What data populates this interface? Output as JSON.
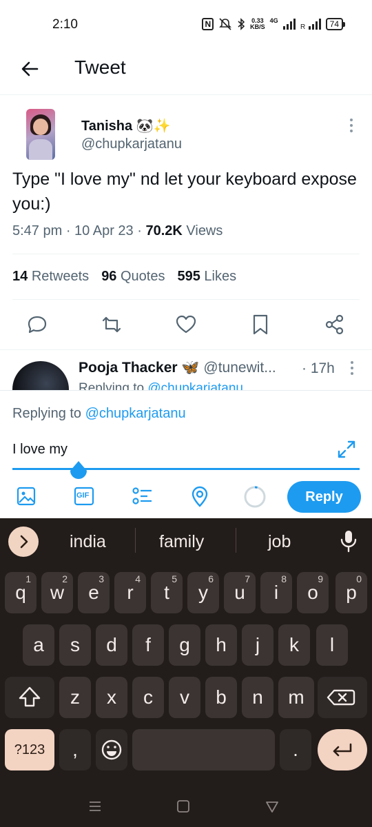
{
  "status": {
    "time": "2:10",
    "nfc": "N",
    "speed_value": "0.33",
    "speed_unit": "KB/S",
    "network": "4G",
    "battery": "74"
  },
  "header": {
    "title": "Tweet"
  },
  "tweet": {
    "display_name": "Tanisha 🐼✨",
    "handle": "@chupkarjatanu",
    "text": "Type \"I love my\" nd let your keyboard expose you:)",
    "time": "5:47 pm",
    "date": "10 Apr 23",
    "views_count": "70.2K",
    "views_label": "Views",
    "retweets_count": "14",
    "retweets_label": "Retweets",
    "quotes_count": "96",
    "quotes_label": "Quotes",
    "likes_count": "595",
    "likes_label": "Likes"
  },
  "reply_preview": {
    "name": "Pooja Thacker 🦋",
    "handle": "@tunewit...",
    "time": "17h",
    "replying_prefix": "Replying to",
    "replying_handle": "@chupkarjatanu"
  },
  "composer": {
    "replying_prefix": "Replying to",
    "replying_handle": "@chupkarjatanu",
    "input_value": "I love my",
    "gif_label": "GIF",
    "reply_button": "Reply"
  },
  "keyboard": {
    "suggestions": [
      "india",
      "family",
      "job"
    ],
    "row1": [
      {
        "key": "q",
        "num": "1"
      },
      {
        "key": "w",
        "num": "2"
      },
      {
        "key": "e",
        "num": "3"
      },
      {
        "key": "r",
        "num": "4"
      },
      {
        "key": "t",
        "num": "5"
      },
      {
        "key": "y",
        "num": "6"
      },
      {
        "key": "u",
        "num": "7"
      },
      {
        "key": "i",
        "num": "8"
      },
      {
        "key": "o",
        "num": "9"
      },
      {
        "key": "p",
        "num": "0"
      }
    ],
    "row2": [
      "a",
      "s",
      "d",
      "f",
      "g",
      "h",
      "j",
      "k",
      "l"
    ],
    "row3": [
      "z",
      "x",
      "c",
      "v",
      "b",
      "n",
      "m"
    ],
    "symbols_key": "?123",
    "comma_key": ",",
    "period_key": "."
  },
  "colors": {
    "accent": "#1d9bf0",
    "keyboard_bg": "#221c1a",
    "key_bg": "#3b3432",
    "key_accent": "#f3d3c2"
  }
}
